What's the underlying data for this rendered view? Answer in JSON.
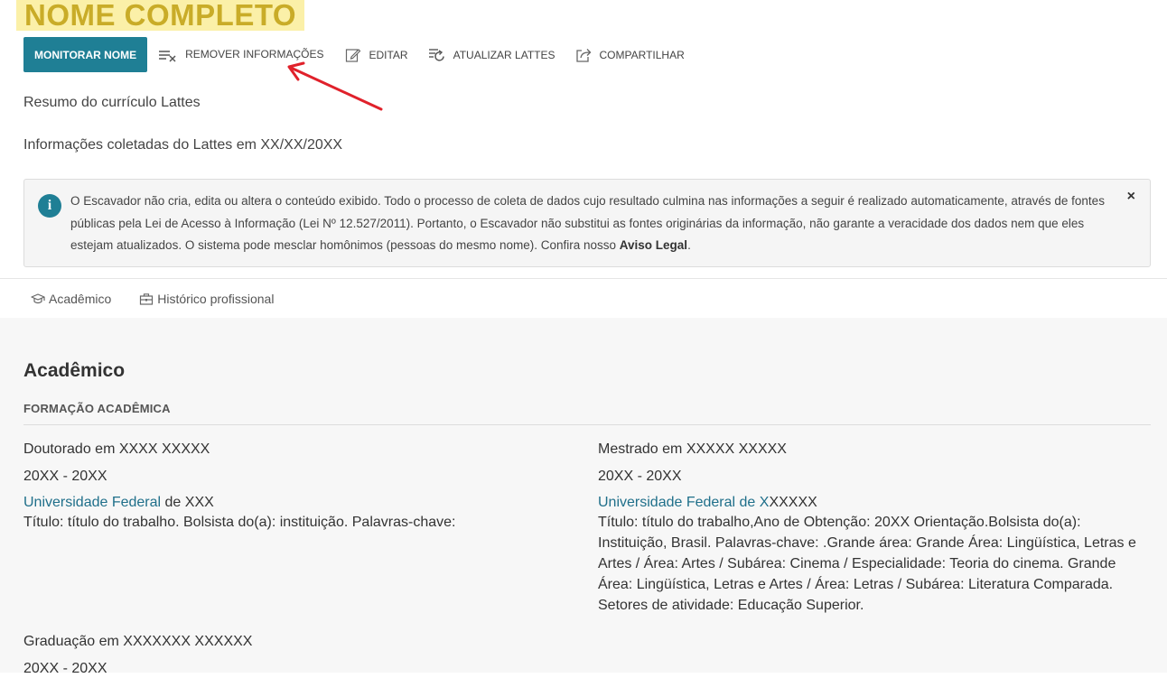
{
  "header": {
    "title": "NOME COMPLETO"
  },
  "toolbar": {
    "monitor_label": "MONITORAR NOME",
    "remove_label": "REMOVER INFORMAÇÕES",
    "edit_label": "EDITAR",
    "update_label": "ATUALIZAR LATTES",
    "share_label": "COMPARTILHAR"
  },
  "summary": {
    "title": "Resumo do currículo Lattes",
    "collected": "Informações coletadas do Lattes em XX/XX/20XX"
  },
  "alert": {
    "text": "O Escavador não cria, edita ou altera o conteúdo exibido. Todo o processo de coleta de dados cujo resultado culmina nas informações a seguir é realizado automaticamente, através de fontes públicas pela Lei de Acesso à Informação (Lei Nº 12.527/2011). Portanto, o Escavador não substitui as fontes originárias da informação, não garante a veracidade dos dados nem que eles estejam atualizados. O sistema pode mesclar homônimos (pessoas do mesmo nome). Confira nosso ",
    "link_text": "Aviso Legal",
    "suffix": ".",
    "close": "×",
    "icon": "info-icon"
  },
  "tabs": [
    {
      "label": "Acadêmico",
      "icon": "graduation-cap-icon"
    },
    {
      "label": "Histórico profissional",
      "icon": "briefcase-icon"
    }
  ],
  "section": {
    "title": "Acadêmico",
    "subtitle": "FORMAÇÃO ACADÊMICA"
  },
  "education": [
    {
      "degree": "Doutorado em XXXX XXXXX",
      "period": "20XX - 20XX",
      "institution_link": "Universidade Federal",
      "institution_rest": " de XXX",
      "description": "Título: título do trabalho. Bolsista do(a): instituição. Palavras-chave:"
    },
    {
      "degree": "Mestrado em XXXXX XXXXX",
      "period": "20XX - 20XX",
      "institution_link": "Universidade Federal de X",
      "institution_rest": "XXXXX",
      "description": "Título: título do trabalho,Ano de Obtenção: 20XX Orientação.Bolsista do(a): Instituição, Brasil. Palavras-chave: .Grande área: Grande Área: Lingüística, Letras e Artes / Área: Artes / Subárea: Cinema / Especialidade: Teoria do cinema. Grande Área: Lingüística, Letras e Artes / Área: Letras / Subárea: Literatura Comparada. Setores de atividade: Educação Superior."
    },
    {
      "degree": "Graduação em XXXXXXX XXXXXX",
      "period": "20XX - 20XX"
    }
  ],
  "annotation": {
    "color": "#e0212b"
  }
}
